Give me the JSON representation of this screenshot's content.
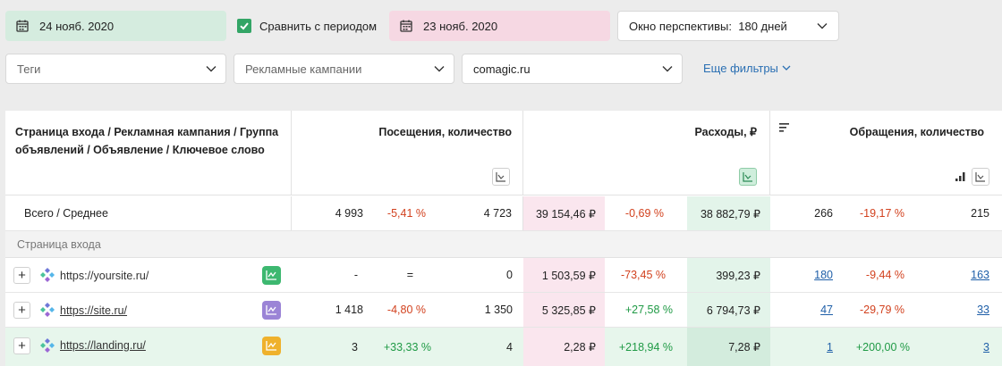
{
  "filters": {
    "date_a": "24 нояб. 2020",
    "compare_label": "Сравнить с периодом",
    "compare_checked": true,
    "date_b": "23 нояб. 2020",
    "window_label": "Окно перспективы:",
    "window_value": "180 дней",
    "tags_placeholder": "Теги",
    "campaigns_placeholder": "Рекламные кампании",
    "site_value": "comagic.ru",
    "more_filters": "Еще фильтры"
  },
  "table": {
    "headers": {
      "dimension": "Страница входа / Рекламная кампания / Группа объявлений / Объявление / Ключевое слово",
      "visits": "Посещения, количество",
      "costs": "Расходы, ₽",
      "requests": "Обращения, количество"
    },
    "total": {
      "label": "Всего / Среднее",
      "visits_a": "4 993",
      "visits_delta": "-5,41 %",
      "visits_b": "4 723",
      "costs_a": "39 154,46 ₽",
      "costs_delta": "-0,69 %",
      "costs_b": "38 882,79 ₽",
      "req_a": "266",
      "req_delta": "-19,17 %",
      "req_b": "215"
    },
    "section_label": "Страница входа",
    "rows": [
      {
        "url": "https://yoursite.ru/",
        "trend_color": "#3db870",
        "visits_a": "-",
        "visits_delta": "=",
        "visits_b": "0",
        "costs_a": "1 503,59 ₽",
        "costs_delta": "-73,45 %",
        "costs_b": "399,23 ₽",
        "req_a": "180",
        "req_delta": "-9,44 %",
        "req_b": "163"
      },
      {
        "url": "https://site.ru/",
        "trend_color": "#9b84d6",
        "visits_a": "1 418",
        "visits_delta": "-4,80 %",
        "visits_b": "1 350",
        "costs_a": "5 325,85 ₽",
        "costs_delta": "+27,58 %",
        "costs_b": "6 794,73 ₽",
        "req_a": "47",
        "req_delta": "-29,79 %",
        "req_b": "33"
      },
      {
        "url": "https://landing.ru/",
        "trend_color": "#efb12c",
        "visits_a": "3",
        "visits_delta": "+33,33 %",
        "visits_b": "4",
        "costs_a": "2,28 ₽",
        "costs_delta": "+218,94 %",
        "costs_b": "7,28 ₽",
        "req_a": "1",
        "req_delta": "+200,00 %",
        "req_b": "3"
      }
    ]
  }
}
